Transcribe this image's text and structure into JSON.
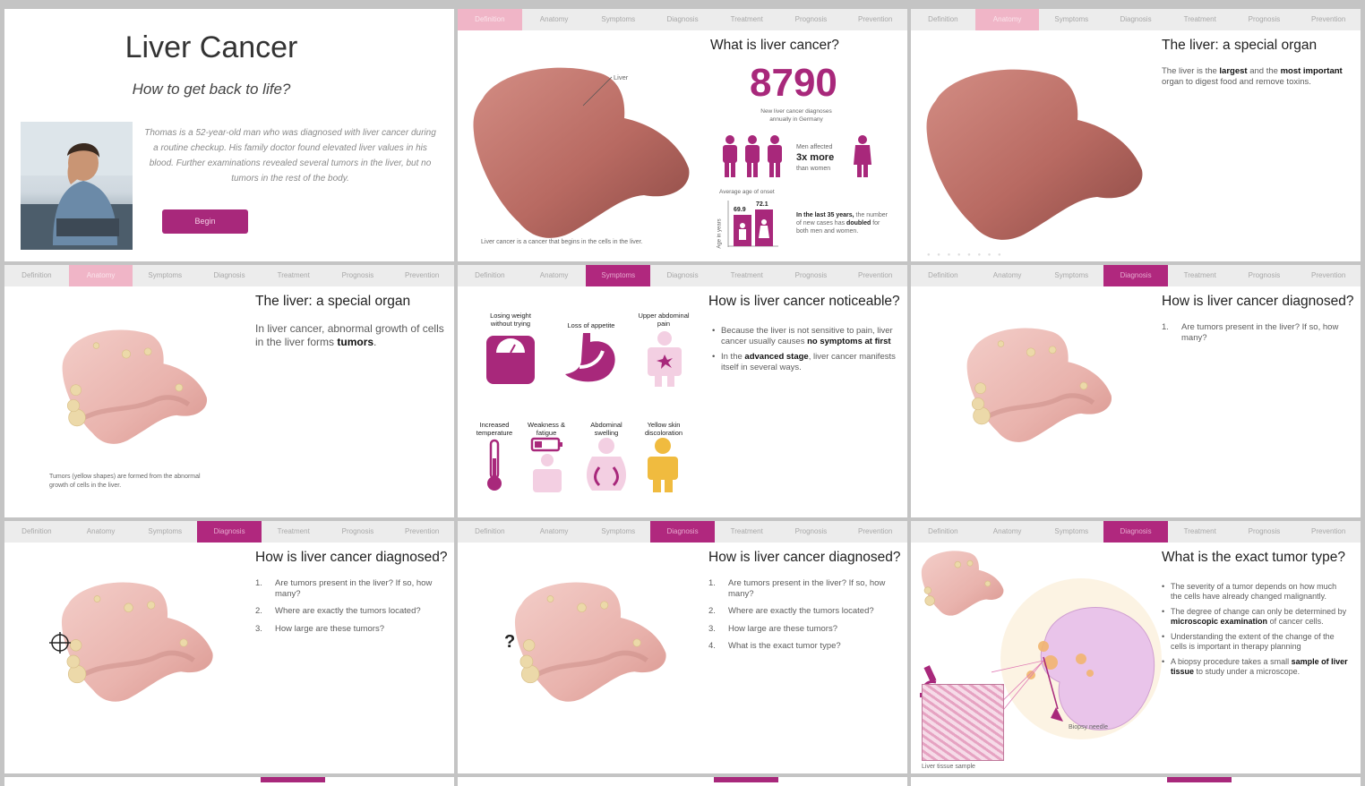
{
  "nav": [
    "Definition",
    "Anatomy",
    "Symptoms",
    "Diagnosis",
    "Treatment",
    "Prognosis",
    "Prevention"
  ],
  "colors": {
    "accent": "#b0287e",
    "accent_light": "#f0b5c7",
    "liver": "#b5665f",
    "liver_pink": "#ecbcb6",
    "tumor": "#ecd9a9"
  },
  "slide1": {
    "title": "Liver Cancer",
    "subtitle": "How to get back to life?",
    "story": "Thomas is a 52-year-old man who was diagnosed with liver cancer during a routine checkup. His family doctor found elevated liver values in his blood. Further examinations revealed several tumors in the liver, but no tumors in the rest of the body.",
    "begin": "Begin"
  },
  "slide2": {
    "title": "What is liver cancer?",
    "liver_label": "Liver",
    "stat": "8790",
    "stat_caption": "New liver cancer diagnoses annually in Germany",
    "men_label": "Men affected",
    "men_value": "3x more",
    "men_sub": "than women",
    "age_label": "Average age of onset",
    "age_axis": "Age in years",
    "age_men": "69.9",
    "age_women": "72.1",
    "trend_bold": "In the last 35 years,",
    "trend_text_a": "the number of new cases has",
    "trend_doubled": "doubled",
    "trend_text_b": "for both men and women.",
    "caption": "Liver cancer is a cancer that begins in the cells in the liver."
  },
  "slide3": {
    "title": "The liver: a special organ",
    "t1": "The liver is the",
    "b1": "largest",
    "t2": "and the",
    "b2": "most important",
    "t3": "organ to digest food and remove toxins."
  },
  "slide4": {
    "title": "The liver: a special organ",
    "t1": "In liver cancer, abnormal growth of cells in the liver forms",
    "b1": "tumors",
    "t2": ".",
    "caption": "Tumors (yellow shapes) are formed from the abnormal growth of cells in the liver."
  },
  "slide5": {
    "title": "How is liver cancer noticeable?",
    "symptoms": [
      "Losing weight without trying",
      "Loss of appetite",
      "Upper abdominal pain",
      "Increased temperature",
      "Weakness & fatigue",
      "Abdominal swelling",
      "Yellow skin discoloration"
    ],
    "p1a": "Because the liver is not sensitive to pain, liver cancer usually causes",
    "p1b": "no symptoms at first",
    "p2a": "In the",
    "p2b": "advanced stage",
    "p2c": ", liver cancer manifests itself in several ways."
  },
  "diagnosis": {
    "title": "How is liver cancer diagnosed?",
    "questions": [
      "Are tumors present in the liver? If so, how many?",
      "Where are exactly the tumors located?",
      "How large are these tumors?",
      "What is the exact tumor type?"
    ]
  },
  "slide9": {
    "title": "What is the exact tumor type?",
    "b1": "The severity of a tumor depends on how much the cells have already changed malignantly.",
    "b2a": "The degree of change can only be determined by",
    "b2b": "microscopic examination",
    "b2c": "of cancer cells.",
    "b3": "Understanding the extent of the change of the cells is important in therapy planning",
    "b4a": "A biopsy procedure takes a small",
    "b4b": "sample of liver tissue",
    "b4c": "to study under a microscope.",
    "needle_label": "Biopsy needle",
    "sample_label": "Liver tissue sample"
  },
  "question_mark": "?"
}
